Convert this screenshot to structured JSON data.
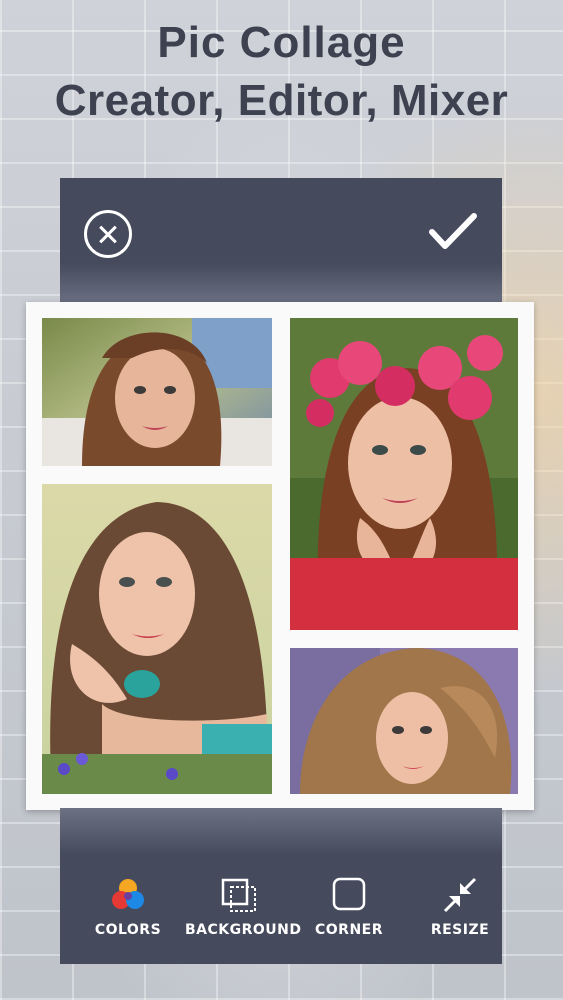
{
  "headline": {
    "line1": "Pic Collage",
    "line2": "Creator, Editor, Mixer"
  },
  "top_bar": {
    "close_icon": "close-circle-icon",
    "confirm_icon": "checkmark-icon"
  },
  "collage": {
    "photos": [
      {
        "name": "photo-top-left",
        "subject": "woman lying on grass"
      },
      {
        "name": "photo-top-right",
        "subject": "woman with pink flower crown"
      },
      {
        "name": "photo-bottom-left",
        "subject": "woman with hands on cheek"
      },
      {
        "name": "photo-bottom-right",
        "subject": "woman with wind-blown hair"
      }
    ]
  },
  "toolbar": {
    "items": [
      {
        "label": "COLORS",
        "icon": "colors-icon"
      },
      {
        "label": "BACKGROUND",
        "icon": "background-icon"
      },
      {
        "label": "CORNER",
        "icon": "corner-icon"
      },
      {
        "label": "RESIZE",
        "icon": "resize-icon"
      }
    ]
  },
  "colors": {
    "panel": "#464a5d",
    "headline": "#3e4150",
    "frame": "#fafafa"
  }
}
